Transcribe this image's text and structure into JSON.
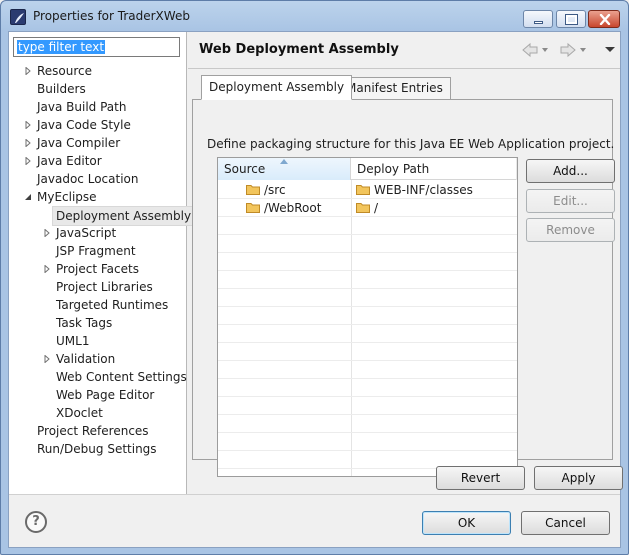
{
  "window": {
    "title": "Properties for TraderXWeb"
  },
  "filter": {
    "value": "type filter text"
  },
  "tree": [
    {
      "label": "Resource",
      "level": 0,
      "expandable": true
    },
    {
      "label": "Builders",
      "level": 0,
      "expandable": false
    },
    {
      "label": "Java Build Path",
      "level": 0,
      "expandable": false
    },
    {
      "label": "Java Code Style",
      "level": 0,
      "expandable": true
    },
    {
      "label": "Java Compiler",
      "level": 0,
      "expandable": true
    },
    {
      "label": "Java Editor",
      "level": 0,
      "expandable": true
    },
    {
      "label": "Javadoc Location",
      "level": 0,
      "expandable": false
    },
    {
      "label": "MyEclipse",
      "level": 0,
      "expandable": true,
      "expanded": true
    },
    {
      "label": "Deployment Assembly",
      "level": 1,
      "expandable": false,
      "selected": true
    },
    {
      "label": "JavaScript",
      "level": 1,
      "expandable": true
    },
    {
      "label": "JSP Fragment",
      "level": 1,
      "expandable": false
    },
    {
      "label": "Project Facets",
      "level": 1,
      "expandable": true
    },
    {
      "label": "Project Libraries",
      "level": 1,
      "expandable": false
    },
    {
      "label": "Targeted Runtimes",
      "level": 1,
      "expandable": false
    },
    {
      "label": "Task Tags",
      "level": 1,
      "expandable": false
    },
    {
      "label": "UML1",
      "level": 1,
      "expandable": false
    },
    {
      "label": "Validation",
      "level": 1,
      "expandable": true
    },
    {
      "label": "Web Content Settings",
      "level": 1,
      "expandable": false
    },
    {
      "label": "Web Page Editor",
      "level": 1,
      "expandable": false
    },
    {
      "label": "XDoclet",
      "level": 1,
      "expandable": false
    },
    {
      "label": "Project References",
      "level": 0,
      "expandable": false
    },
    {
      "label": "Run/Debug Settings",
      "level": 0,
      "expandable": false
    }
  ],
  "page": {
    "title": "Web Deployment Assembly",
    "tabs": [
      "Deployment Assembly",
      "Manifest Entries"
    ],
    "description": "Define packaging structure for this Java EE Web Application project.",
    "columns": [
      "Source",
      "Deploy Path"
    ],
    "rows": [
      {
        "source": "/src",
        "deploy": "WEB-INF/classes"
      },
      {
        "source": "/WebRoot",
        "deploy": "/"
      }
    ],
    "side_buttons": {
      "add": "Add...",
      "edit": "Edit...",
      "remove": "Remove"
    },
    "revert": "Revert",
    "apply": "Apply"
  },
  "footer": {
    "ok": "OK",
    "cancel": "Cancel",
    "help_symbol": "?"
  },
  "colors": {
    "selection": "#3399ff",
    "folder": "#e8b64a",
    "title_bar": "#a9c4e4"
  }
}
